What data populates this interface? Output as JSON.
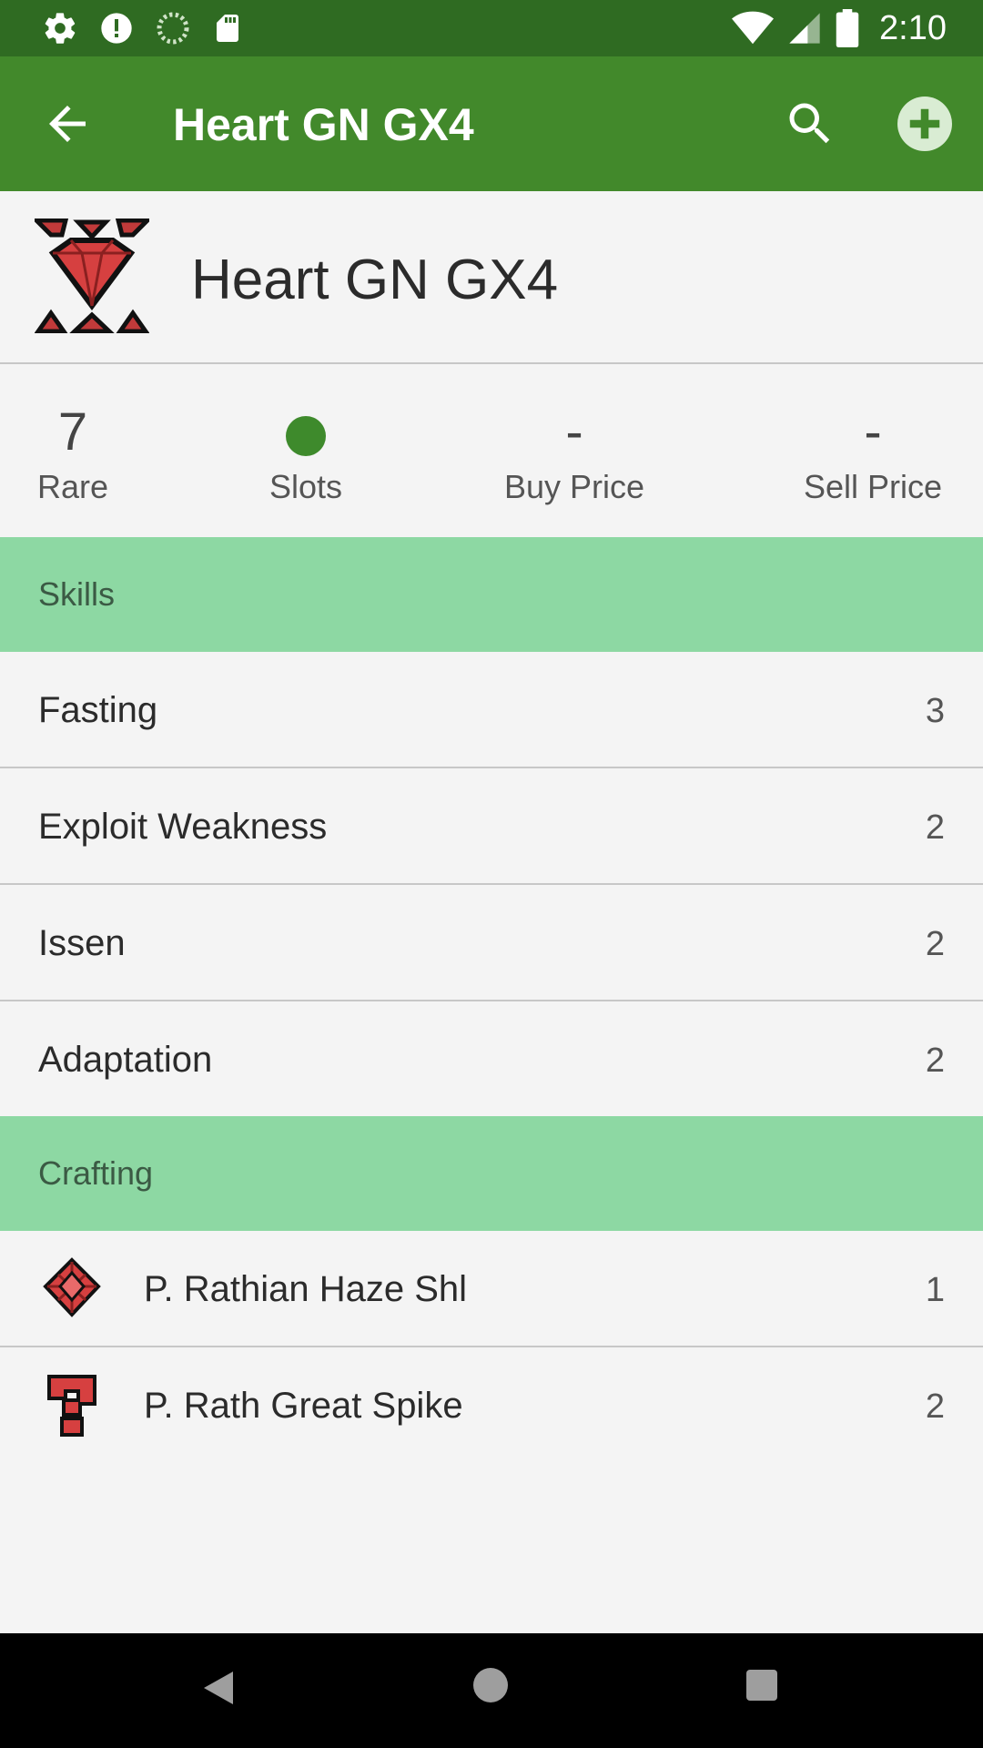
{
  "status_bar": {
    "time": "2:10",
    "left_icons": [
      "settings-icon",
      "alert-icon",
      "sync-icon",
      "sd-card-icon"
    ],
    "right_icons": [
      "wifi-icon",
      "signal-icon",
      "battery-icon"
    ]
  },
  "app_bar": {
    "title": "Heart GN GX4",
    "actions": [
      "search-icon",
      "add-circle-icon"
    ]
  },
  "item": {
    "name": "Heart GN GX4",
    "icon": "red-gem-armor-icon"
  },
  "stats": {
    "rare": {
      "value": "7",
      "label": "Rare"
    },
    "slots": {
      "value": 1,
      "label": "Slots"
    },
    "buy": {
      "value": "-",
      "label": "Buy Price"
    },
    "sell": {
      "value": "-",
      "label": "Sell Price"
    }
  },
  "skills_header": "Skills",
  "skills": [
    {
      "name": "Fasting",
      "level": "3"
    },
    {
      "name": "Exploit Weakness",
      "level": "2"
    },
    {
      "name": "Issen",
      "level": "2"
    },
    {
      "name": "Adaptation",
      "level": "2"
    }
  ],
  "crafting_header": "Crafting",
  "crafting": [
    {
      "name": "P. Rathian Haze Shl",
      "qty": "1",
      "icon": "red-shell-icon"
    },
    {
      "name": "P. Rath Great Spike",
      "qty": "2",
      "icon": "red-question-mark-icon"
    }
  ],
  "colors": {
    "status_bar": "#2f6b22",
    "app_bar": "#42892b",
    "section_header": "#8dd8a3",
    "slot_dot": "#3e8a2c",
    "item_red": "#d64040"
  }
}
